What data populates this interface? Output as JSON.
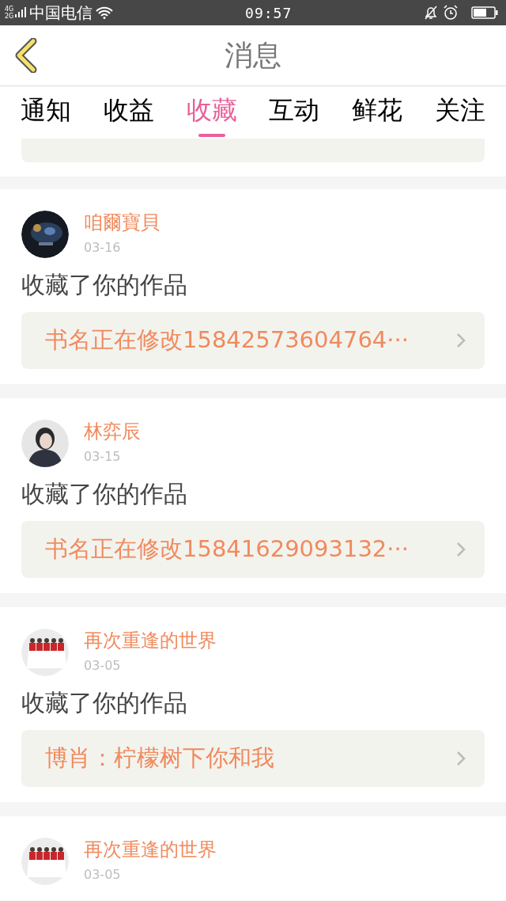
{
  "status_bar": {
    "network_top": "4G",
    "network_bottom": "2G",
    "carrier": "中国电信",
    "time": "09:57"
  },
  "header": {
    "title": "消息"
  },
  "tabs": [
    {
      "label": "通知",
      "selected": false
    },
    {
      "label": "收益",
      "selected": false
    },
    {
      "label": "收藏",
      "selected": true
    },
    {
      "label": "互动",
      "selected": false
    },
    {
      "label": "鲜花",
      "selected": false
    },
    {
      "label": "关注",
      "selected": false
    }
  ],
  "messages": [
    {
      "name": "咱爾寶貝",
      "date": "03-16",
      "action": "收藏了你的作品",
      "book": "书名正在修改15842573604764···"
    },
    {
      "name": "林弈辰",
      "date": "03-15",
      "action": "收藏了你的作品",
      "book": "书名正在修改15841629093132···"
    },
    {
      "name": "再次重逢的世界",
      "date": "03-05",
      "action": "收藏了你的作品",
      "book": "博肖：柠檬树下你和我"
    },
    {
      "name": "再次重逢的世界",
      "date": "03-05"
    }
  ]
}
